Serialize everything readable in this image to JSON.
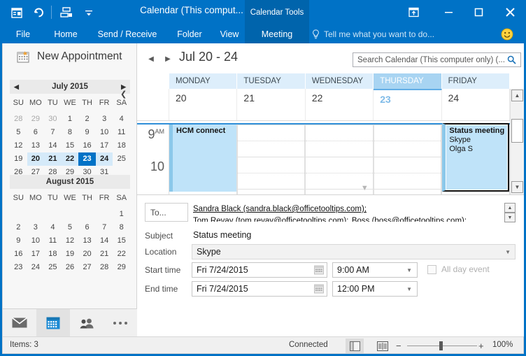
{
  "titlebar": {
    "quick_access": [
      {
        "name": "new-appointment-qat-icon",
        "label": "New Appointment"
      },
      {
        "name": "undo-qat-icon",
        "label": "Undo"
      },
      {
        "name": "scheduling-assistant-qat-icon",
        "label": "Scheduling"
      },
      {
        "name": "customize-qat-icon",
        "label": "Customize Quick Access Toolbar"
      }
    ],
    "title": "Calendar (This comput...",
    "contextual_tool": "Calendar Tools",
    "window_buttons": [
      {
        "name": "ribbon-display-options-button",
        "label": "Ribbon Display Options"
      },
      {
        "name": "minimize-button",
        "label": "Minimize"
      },
      {
        "name": "restore-button",
        "label": "Restore"
      },
      {
        "name": "close-button",
        "label": "Close"
      }
    ]
  },
  "ribbon": {
    "tabs": [
      {
        "label": "File",
        "active": false
      },
      {
        "label": "Home",
        "active": false
      },
      {
        "label": "Send / Receive",
        "active": false
      },
      {
        "label": "Folder",
        "active": false
      },
      {
        "label": "View",
        "active": false
      },
      {
        "label": "Meeting",
        "active": true
      }
    ],
    "tellme": "Tell me what you want to do...",
    "smiley": "🙂"
  },
  "sidebar": {
    "new_appointment": "New Appointment",
    "collapse_label": "❮",
    "datenav": [
      {
        "title": "July 2015",
        "prev": "◀",
        "next": "▶",
        "dow": [
          "SU",
          "MO",
          "TU",
          "WE",
          "TH",
          "FR",
          "SA"
        ],
        "weeks": [
          [
            {
              "d": "28",
              "s": "muted"
            },
            {
              "d": "29",
              "s": "muted"
            },
            {
              "d": "30",
              "s": "muted"
            },
            {
              "d": "1",
              "s": ""
            },
            {
              "d": "2",
              "s": ""
            },
            {
              "d": "3",
              "s": ""
            },
            {
              "d": "4",
              "s": ""
            }
          ],
          [
            {
              "d": "5",
              "s": ""
            },
            {
              "d": "6",
              "s": ""
            },
            {
              "d": "7",
              "s": ""
            },
            {
              "d": "8",
              "s": ""
            },
            {
              "d": "9",
              "s": ""
            },
            {
              "d": "10",
              "s": ""
            },
            {
              "d": "11",
              "s": ""
            }
          ],
          [
            {
              "d": "12",
              "s": ""
            },
            {
              "d": "13",
              "s": ""
            },
            {
              "d": "14",
              "s": ""
            },
            {
              "d": "15",
              "s": ""
            },
            {
              "d": "16",
              "s": ""
            },
            {
              "d": "17",
              "s": ""
            },
            {
              "d": "18",
              "s": ""
            }
          ],
          [
            {
              "d": "19",
              "s": ""
            },
            {
              "d": "20",
              "s": "wkhl"
            },
            {
              "d": "21",
              "s": "wkhl"
            },
            {
              "d": "22",
              "s": "wkhl"
            },
            {
              "d": "23",
              "s": "sel"
            },
            {
              "d": "24",
              "s": "wkhl"
            },
            {
              "d": "25",
              "s": ""
            }
          ],
          [
            {
              "d": "26",
              "s": ""
            },
            {
              "d": "27",
              "s": ""
            },
            {
              "d": "28",
              "s": ""
            },
            {
              "d": "29",
              "s": ""
            },
            {
              "d": "30",
              "s": ""
            },
            {
              "d": "31",
              "s": ""
            },
            {
              "d": "",
              "s": ""
            }
          ]
        ]
      },
      {
        "title": "August 2015",
        "prev": "",
        "next": "",
        "dow": [
          "SU",
          "MO",
          "TU",
          "WE",
          "TH",
          "FR",
          "SA"
        ],
        "weeks": [
          [
            {
              "d": "",
              "s": ""
            },
            {
              "d": "",
              "s": ""
            },
            {
              "d": "",
              "s": ""
            },
            {
              "d": "",
              "s": ""
            },
            {
              "d": "",
              "s": ""
            },
            {
              "d": "",
              "s": ""
            },
            {
              "d": "1",
              "s": ""
            }
          ],
          [
            {
              "d": "2",
              "s": ""
            },
            {
              "d": "3",
              "s": ""
            },
            {
              "d": "4",
              "s": ""
            },
            {
              "d": "5",
              "s": ""
            },
            {
              "d": "6",
              "s": ""
            },
            {
              "d": "7",
              "s": ""
            },
            {
              "d": "8",
              "s": ""
            }
          ],
          [
            {
              "d": "9",
              "s": ""
            },
            {
              "d": "10",
              "s": ""
            },
            {
              "d": "11",
              "s": ""
            },
            {
              "d": "12",
              "s": ""
            },
            {
              "d": "13",
              "s": ""
            },
            {
              "d": "14",
              "s": ""
            },
            {
              "d": "15",
              "s": ""
            }
          ],
          [
            {
              "d": "16",
              "s": ""
            },
            {
              "d": "17",
              "s": ""
            },
            {
              "d": "18",
              "s": ""
            },
            {
              "d": "19",
              "s": ""
            },
            {
              "d": "20",
              "s": ""
            },
            {
              "d": "21",
              "s": ""
            },
            {
              "d": "22",
              "s": ""
            }
          ],
          [
            {
              "d": "23",
              "s": ""
            },
            {
              "d": "24",
              "s": ""
            },
            {
              "d": "25",
              "s": ""
            },
            {
              "d": "26",
              "s": ""
            },
            {
              "d": "27",
              "s": ""
            },
            {
              "d": "28",
              "s": ""
            },
            {
              "d": "29",
              "s": ""
            }
          ]
        ]
      }
    ],
    "nav_buttons": [
      {
        "name": "mail-nav-icon",
        "label": "Mail",
        "active": false
      },
      {
        "name": "calendar-nav-icon",
        "label": "Calendar",
        "active": true
      },
      {
        "name": "people-nav-icon",
        "label": "People",
        "active": false
      },
      {
        "name": "more-nav-icon",
        "label": "More",
        "active": false
      }
    ]
  },
  "calendar": {
    "prev_arrow": "◀",
    "next_arrow": "▶",
    "date_range": "Jul 20 - 24",
    "search_placeholder": "Search Calendar (This computer only) (...",
    "days": [
      {
        "name": "MONDAY",
        "num": "20",
        "today": false
      },
      {
        "name": "TUESDAY",
        "num": "21",
        "today": false
      },
      {
        "name": "WEDNESDAY",
        "num": "22",
        "today": false
      },
      {
        "name": "THURSDAY",
        "num": "23",
        "today": true
      },
      {
        "name": "FRIDAY",
        "num": "24",
        "today": false
      }
    ],
    "hours": [
      {
        "label": "9",
        "sup": "AM"
      },
      {
        "label": "10",
        "sup": ""
      }
    ],
    "appointments": [
      {
        "day_index": 0,
        "title": "HCM connect",
        "line2": "",
        "line3": "",
        "selected": false
      },
      {
        "day_index": 4,
        "title": "Status meeting",
        "line2": "Skype",
        "line3": "Olga S",
        "selected": true
      }
    ],
    "more_indicator": "▼"
  },
  "form": {
    "to_label": "To...",
    "recipients": [
      "Sandra Black (sandra.black@officetooltips.com);",
      "Tom Revay (tom.revay@officetooltips.com);",
      "Boss (boss@officetooltips.com);"
    ],
    "subject_label": "Subject",
    "subject_value": "Status meeting",
    "location_label": "Location",
    "location_value": "Skype",
    "start_label": "Start time",
    "start_date": "Fri 7/24/2015",
    "start_time": "9:00 AM",
    "end_label": "End time",
    "end_date": "Fri 7/24/2015",
    "end_time": "12:00 PM",
    "all_day_label": "All day event",
    "all_day_checked": false
  },
  "statusbar": {
    "items": "Items: 3",
    "connected": "Connected",
    "view_buttons": [
      {
        "name": "normal-view-button",
        "active": true
      },
      {
        "name": "reading-view-button",
        "active": false
      }
    ],
    "zoom_minus": "−",
    "zoom_plus": "+",
    "zoom_percent": "100%"
  },
  "colors": {
    "accent": "#0072c6",
    "accent_dark": "#0064ac",
    "appointment_fill": "#bfe3f9",
    "appointment_stripe": "#8cc8ea",
    "today_header": "#a8d4f2",
    "day_header": "#ddeefb"
  }
}
